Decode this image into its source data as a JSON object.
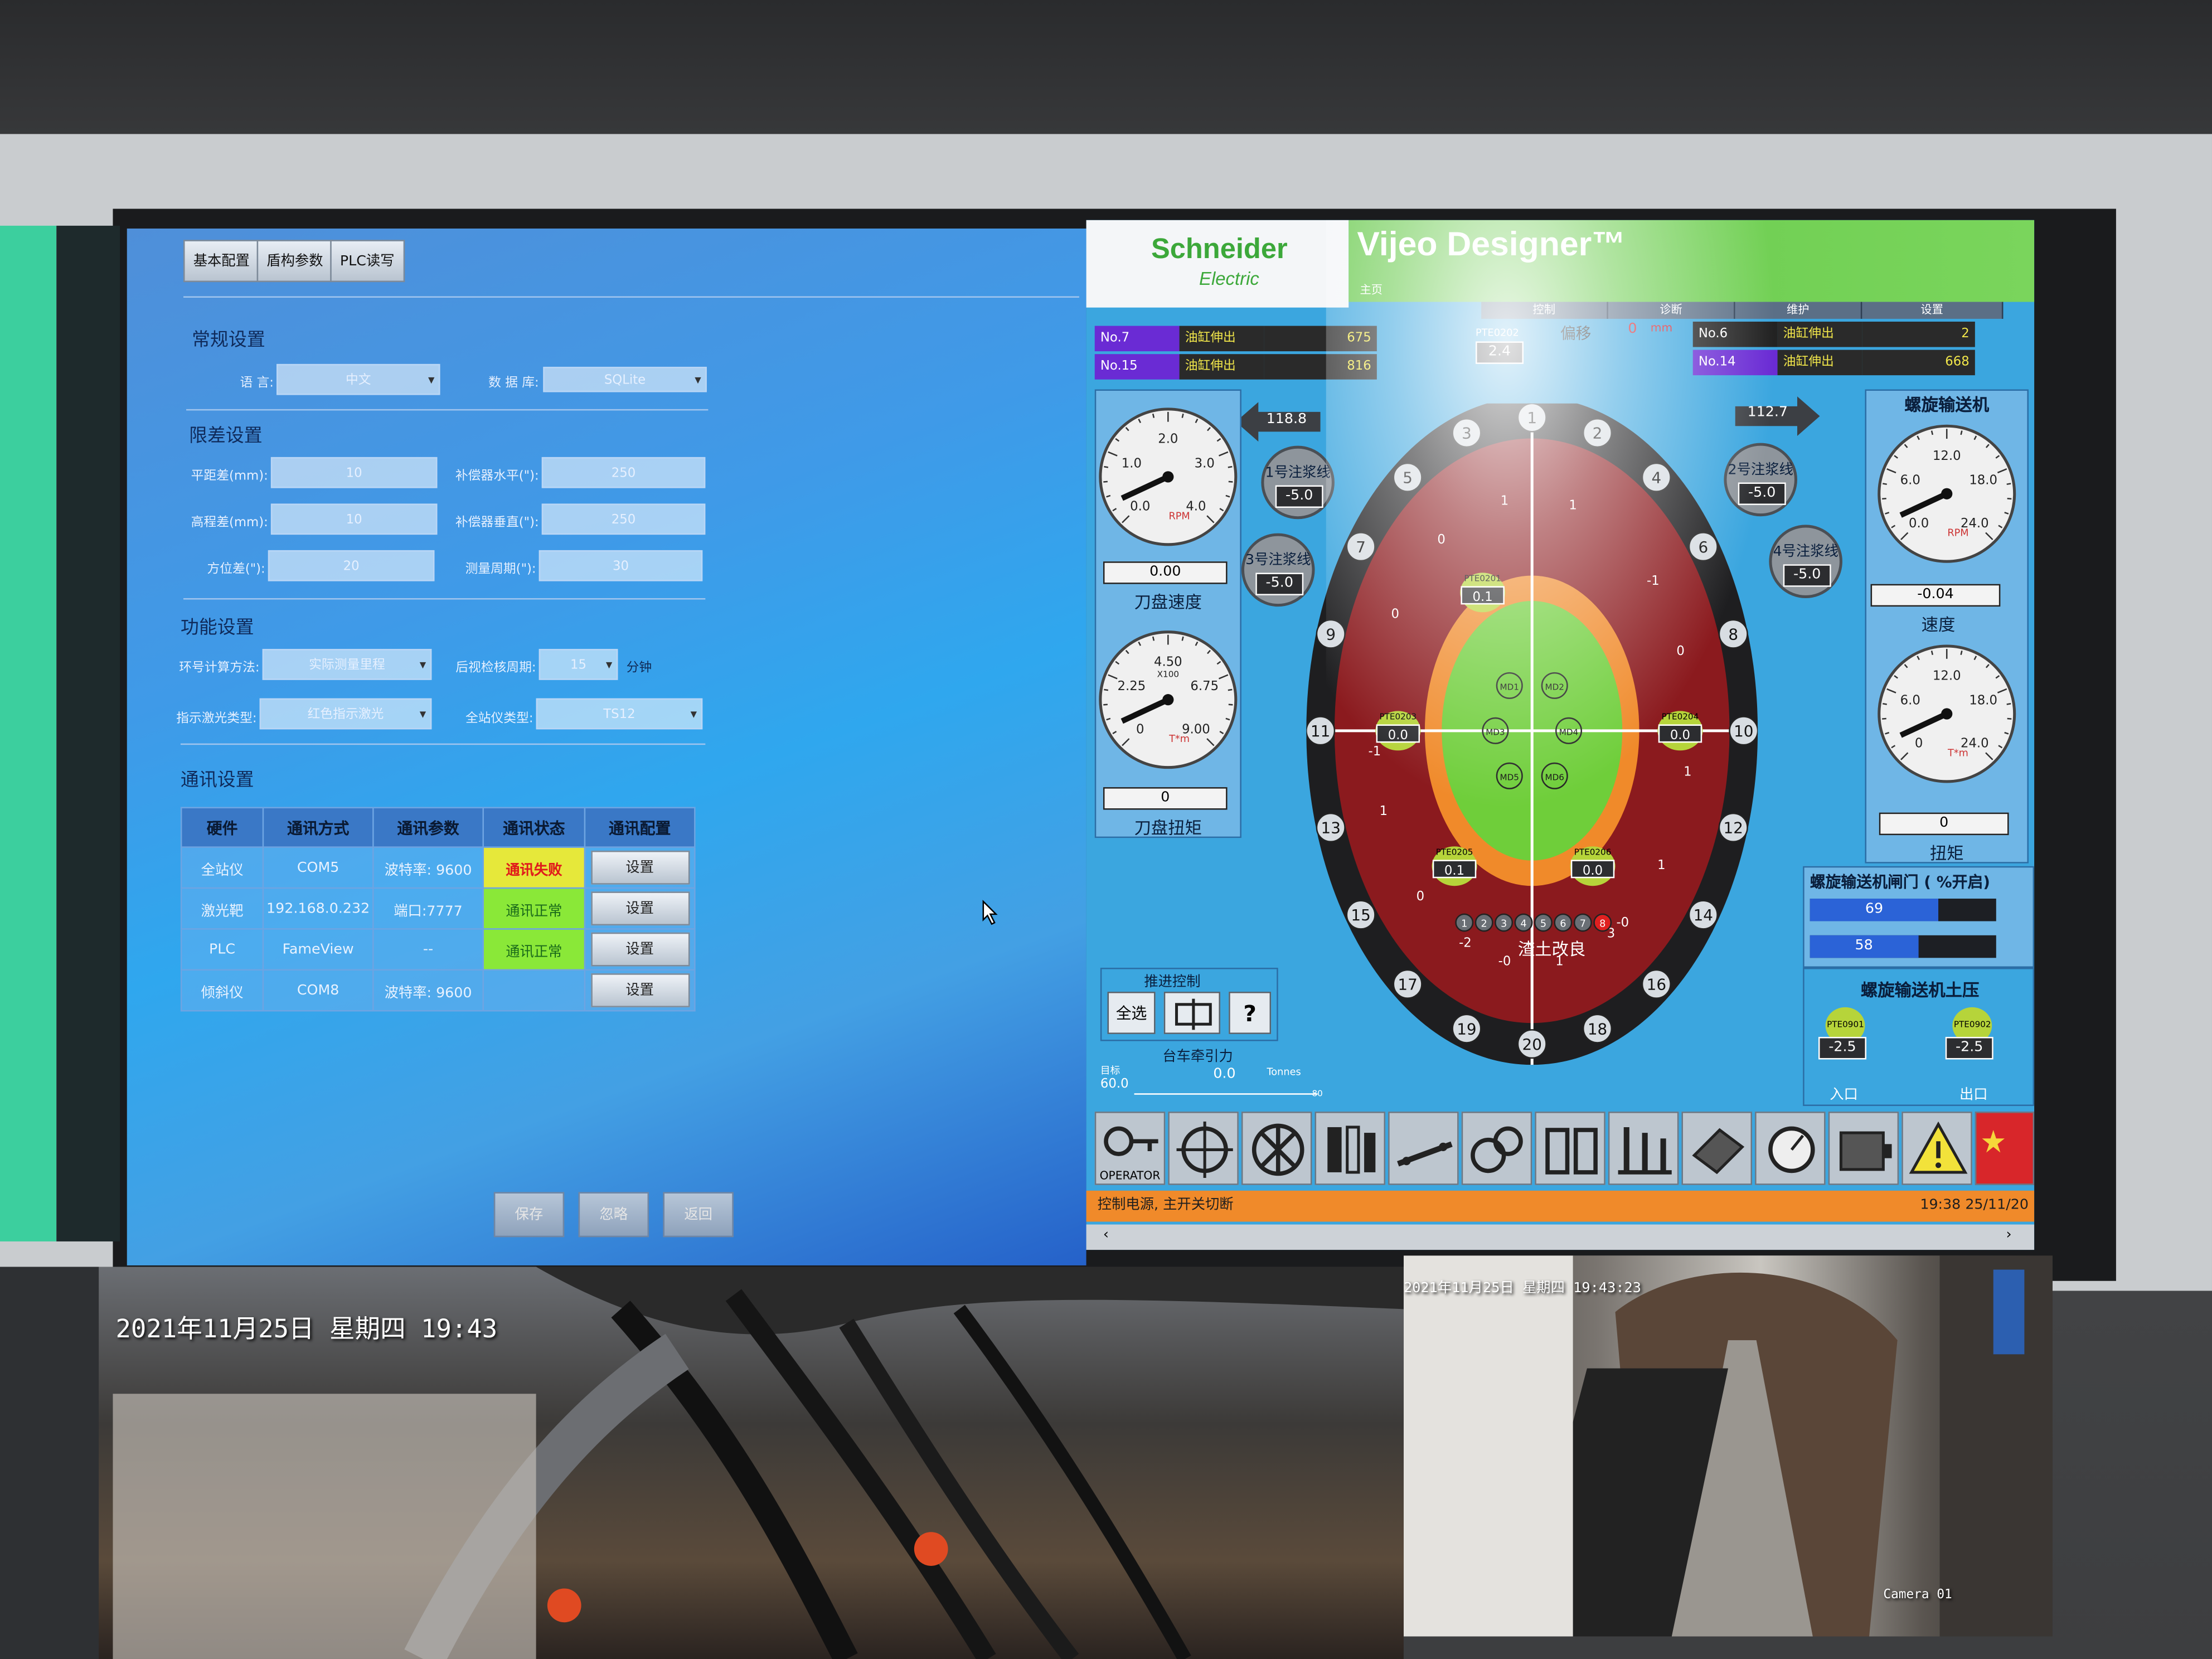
{
  "left_panel": {
    "tabs": [
      "基本配置",
      "盾构参数",
      "PLC读写"
    ],
    "general": {
      "title": "常规设置",
      "language_label": "语    言:",
      "language_value": "中文",
      "database_label": "数 据 库:",
      "database_value": "SQLite"
    },
    "tolerance": {
      "title": "限差设置",
      "rows": [
        {
          "label": "平距差(mm):",
          "value": "10",
          "label2": "补偿器水平(\"):",
          "value2": "250"
        },
        {
          "label": "高程差(mm):",
          "value": "10",
          "label2": "补偿器垂直(\"):",
          "value2": "250"
        },
        {
          "label": "方位差(\"):",
          "value": "20",
          "label2": "测量周期(\"):",
          "value2": "30"
        }
      ]
    },
    "function": {
      "title": "功能设置",
      "ring_calc_label": "环号计算方法:",
      "ring_calc_value": "实际测量里程",
      "period_label": "后视检核周期:",
      "period_value": "15",
      "period_unit": "分钟",
      "laser_label": "指示激光类型:",
      "laser_value": "红色指示激光",
      "station_label": "全站仪类型:",
      "station_value": "TS12"
    },
    "comm": {
      "title": "通讯设置",
      "headers": [
        "硬件",
        "通讯方式",
        "通讯参数",
        "通讯状态",
        "通讯配置"
      ],
      "rows": [
        {
          "hw": "全站仪",
          "method": "COM5",
          "param": "波特率: 9600",
          "status": "通讯失败",
          "status_type": "fail",
          "config": "设置"
        },
        {
          "hw": "激光靶",
          "method": "192.168.0.232",
          "param": "端口:7777",
          "status": "通讯正常",
          "status_type": "ok",
          "config": "设置"
        },
        {
          "hw": "PLC",
          "method": "FameView",
          "param": "--",
          "status": "通讯正常",
          "status_type": "ok",
          "config": "设置"
        },
        {
          "hw": "倾斜仪",
          "method": "COM8",
          "param": "波特率: 9600",
          "status": "",
          "status_type": "none",
          "config": "设置"
        }
      ]
    },
    "buttons": {
      "save": "保存",
      "ignore": "忽略",
      "back": "返回"
    }
  },
  "right_panel": {
    "logo_line1": "Schneider",
    "logo_line2": "Electric",
    "brand": "Vijeo Designer™",
    "subtitle": "主页",
    "nav_tabs": [
      "控制",
      "诊断",
      "维护",
      "设置"
    ],
    "cylinders_left": [
      {
        "no": "No.7",
        "name": "油缸伸出",
        "value": "675"
      },
      {
        "no": "No.15",
        "name": "油缸伸出",
        "value": "816"
      }
    ],
    "cylinders_right": [
      {
        "no": "No.6",
        "name": "油缸伸出",
        "value": "2"
      },
      {
        "no": "No.14",
        "name": "油缸伸出",
        "value": "668"
      }
    ],
    "pte0202": {
      "tag": "PTE0202",
      "value": "2.4"
    },
    "offset": {
      "label": "偏移",
      "value": "0",
      "unit": "mm"
    },
    "arrow_left_value": "118.8",
    "arrow_right_value": "112.7",
    "cutter_speed": {
      "readout": "0.00",
      "caption": "刀盘速度",
      "ticks": [
        "0.0",
        "1.0",
        "2.0",
        "3.0",
        "4.0"
      ],
      "unit": "RPM"
    },
    "cutter_torque": {
      "readout": "0",
      "caption": "刀盘扭矩",
      "ticks": [
        "0",
        "2.25",
        "4.50",
        "6.75",
        "9.00"
      ],
      "unit": "T*m",
      "multiplier": "X100"
    },
    "injections": [
      {
        "label": "1号注浆线",
        "value": "-5.0"
      },
      {
        "label": "3号注浆线",
        "value": "-5.0"
      },
      {
        "label": "2号注浆线",
        "value": "-5.0"
      },
      {
        "label": "4号注浆线",
        "value": "-5.0"
      }
    ],
    "screw": {
      "title": "螺旋输送机",
      "speed_readout": "-0.04",
      "speed_caption": "速度",
      "speed_ticks": [
        "0.0",
        "6.0",
        "12.0",
        "18.0",
        "24.0"
      ],
      "speed_unit": "RPM",
      "torque_readout": "0",
      "torque_caption": "扭矩",
      "torque_ticks": [
        "0",
        "6.0",
        "12.0",
        "18.0",
        "24.0"
      ],
      "torque_unit": "T*m",
      "gate_title": "螺旋输送机闸门 ( %开启)",
      "gate_values": [
        69,
        58
      ],
      "pressure_title": "螺旋输送机土压",
      "pte0901": {
        "tag": "PTE0901",
        "value": "-2.5",
        "label": "入口"
      },
      "pte0902": {
        "tag": "PTE0902",
        "value": "-2.5",
        "label": "出口"
      }
    },
    "dial": {
      "numbers": [
        "1",
        "2",
        "3",
        "4",
        "5",
        "6",
        "7",
        "8",
        "9",
        "10",
        "11",
        "12",
        "13",
        "14",
        "15",
        "16",
        "17",
        "18",
        "19",
        "20"
      ],
      "inner_marks": [
        "1",
        "1",
        "-1",
        "0",
        "0",
        "0",
        "-1",
        "1",
        "3",
        "1",
        "-2",
        "1",
        "-0",
        "1",
        "0",
        "-0"
      ],
      "pte0201": {
        "tag": "PTE0201",
        "value": "0.1"
      },
      "pte0203": {
        "tag": "PTE0203",
        "value": "0.0"
      },
      "pte0204": {
        "tag": "PTE0204",
        "value": "0.0"
      },
      "pte0205": {
        "tag": "PTE0205",
        "value": "0.1"
      },
      "pte0206": {
        "tag": "PTE0206",
        "value": "0.0"
      },
      "md_labels": [
        "MD1",
        "MD2",
        "MD3",
        "MD4",
        "MD5",
        "MD6"
      ],
      "soil_dots": [
        "1",
        "2",
        "3",
        "4",
        "5",
        "6",
        "7",
        "8"
      ],
      "soil_caption": "渣土改良"
    },
    "thrust": {
      "title": "推进控制",
      "select_all": "全选",
      "help": "?",
      "traction_title": "台车牵引力",
      "target_label": "目标",
      "target_value": "60.0",
      "traction_value": "0.0",
      "traction_unit": "Tonnes",
      "scale_max": "80"
    },
    "operator_label": "OPERATOR",
    "status_text": "控制电源, 主开关切断",
    "status_time": "19:38 25/11/20",
    "colors": {
      "accent_green": "#66c94a",
      "orange": "#f08a2a",
      "dial_red": "#8b1a1e",
      "dial_green": "#6fce3a"
    }
  },
  "cameras": {
    "left_timestamp": "2021年11月25日  星期四  19:43",
    "right_timestamp": "2021年11月25日  星期四  19:43:23",
    "right_label": "Camera 01"
  }
}
